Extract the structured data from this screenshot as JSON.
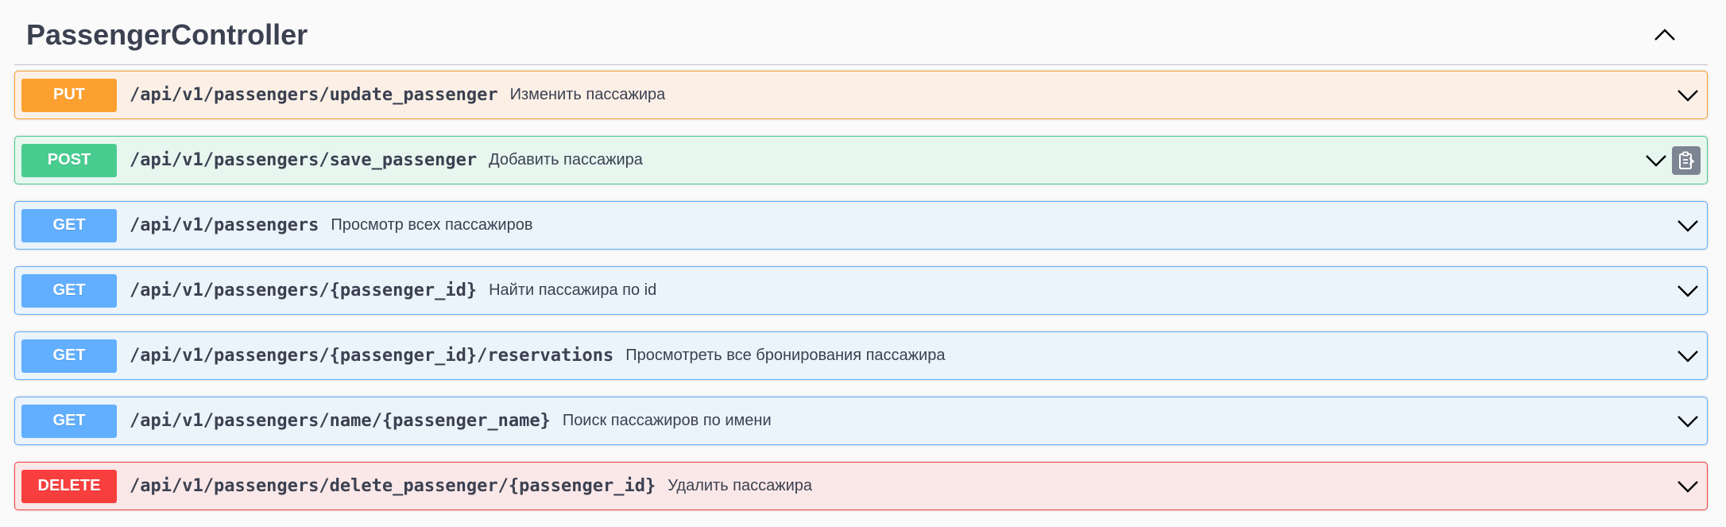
{
  "section": {
    "title": "PassengerController",
    "collapse_icon": "chevron-up-icon"
  },
  "operations": [
    {
      "method": "PUT",
      "path": "/api/v1/passengers/update_passenger",
      "summary": "Изменить пассажира",
      "color": "#fca130"
    },
    {
      "method": "POST",
      "path": "/api/v1/passengers/save_passenger",
      "summary": "Добавить пассажира",
      "color": "#49cc90"
    },
    {
      "method": "GET",
      "path": "/api/v1/passengers",
      "summary": "Просмотр всех пассажиров",
      "color": "#61affe"
    },
    {
      "method": "GET",
      "path": "/api/v1/passengers/{passenger_id}",
      "summary": "Найти пассажира по id",
      "color": "#61affe"
    },
    {
      "method": "GET",
      "path": "/api/v1/passengers/{passenger_id}/reservations",
      "summary": "Просмотреть все бронирования пассажира",
      "color": "#61affe"
    },
    {
      "method": "GET",
      "path": "/api/v1/passengers/name/{passenger_name}",
      "summary": "Поиск пассажиров по имени",
      "color": "#61affe"
    },
    {
      "method": "DELETE",
      "path": "/api/v1/passengers/delete_passenger/{passenger_id}",
      "summary": "Удалить пассажира",
      "color": "#f93e3e"
    }
  ],
  "icons": {
    "expand": "chevron-down-icon",
    "copy": "clipboard-copy-icon"
  }
}
